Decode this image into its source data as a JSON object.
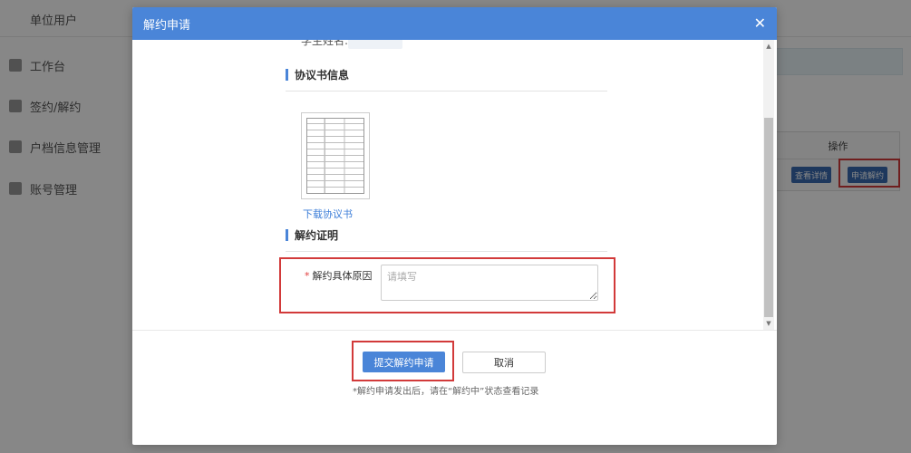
{
  "background": {
    "title": "单位用户",
    "sidebar": [
      {
        "label": "工作台"
      },
      {
        "label": "签约/解约"
      },
      {
        "label": "户档信息管理"
      },
      {
        "label": "账号管理"
      }
    ],
    "table": {
      "header": "操作",
      "buttons": [
        "查看详情",
        "申请解约"
      ]
    }
  },
  "modal": {
    "title": "解约申请",
    "close_icon": "close-icon",
    "truncated_field": "学生姓名:",
    "agreement_section": {
      "title": "协议书信息",
      "download_link": "下载协议书"
    },
    "proof_section": {
      "title": "解约证明",
      "reason_label": "解约具体原因",
      "required_mark": "*",
      "reason_placeholder": "请填写",
      "reason_value": ""
    },
    "footer": {
      "submit_label": "提交解约申请",
      "cancel_label": "取消",
      "note": "*解约申请发出后，请在“解约中”状态查看记录"
    }
  },
  "colors": {
    "header_blue": "#4a85d8",
    "highlight_red": "#d23a3a",
    "required_red": "#e23c3c"
  }
}
